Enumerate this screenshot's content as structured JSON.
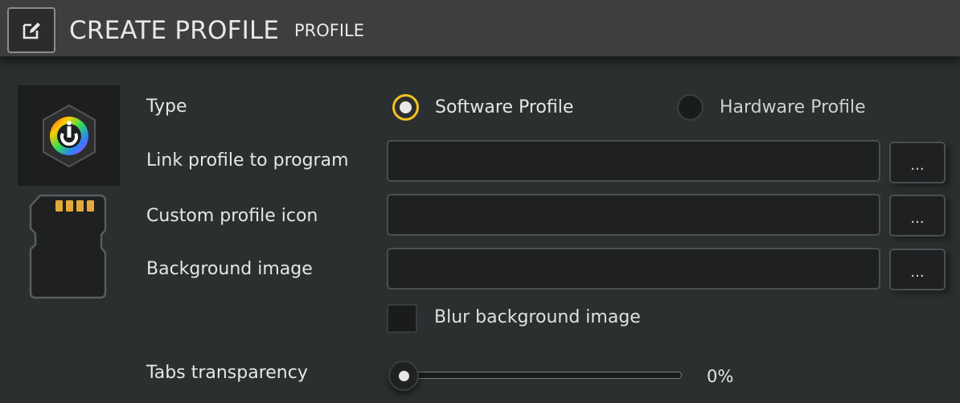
{
  "header": {
    "title": "CREATE PROFILE",
    "subtitle": "PROFILE",
    "icon": "edit-icon"
  },
  "profile_preview": {
    "logo_icon": "icue-logo-icon",
    "device_icon": "sd-card-icon"
  },
  "form": {
    "type": {
      "label": "Type",
      "options": [
        {
          "label": "Software Profile",
          "selected": true
        },
        {
          "label": "Hardware Profile",
          "selected": false
        }
      ]
    },
    "link_program": {
      "label": "Link profile to program",
      "value": "",
      "browse_label": "..."
    },
    "custom_icon": {
      "label": "Custom profile icon",
      "value": "",
      "browse_label": "..."
    },
    "background_image": {
      "label": "Background image",
      "value": "",
      "browse_label": "..."
    },
    "blur_background": {
      "label": "Blur background image",
      "checked": false
    },
    "tabs_transparency": {
      "label": "Tabs transparency",
      "value_text": "0%",
      "value": 0
    }
  },
  "colors": {
    "accent": "#f3c222",
    "background": "#2b2f2f",
    "titlebar": "#3c3e40"
  }
}
